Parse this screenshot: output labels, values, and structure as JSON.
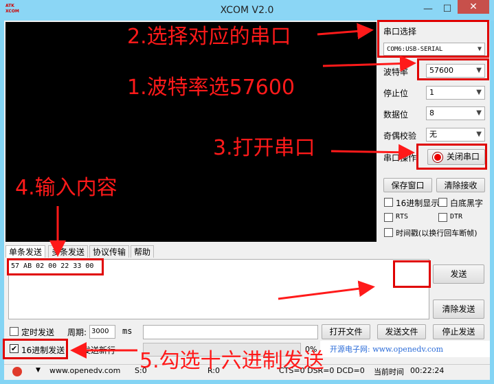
{
  "window": {
    "title": "XCOM V2.0",
    "logo_text": "ATK XCOM",
    "minimize": "—",
    "maximize": "☐",
    "close": "✕"
  },
  "serial": {
    "port_label": "串口选择",
    "port_value": "COM6:USB-SERIAL",
    "baud_label": "波特率",
    "baud_value": "57600",
    "stop_label": "停止位",
    "stop_value": "1",
    "data_label": "数据位",
    "data_value": "8",
    "parity_label": "奇偶校验",
    "parity_value": "无",
    "op_label": "串口操作",
    "op_button": "关闭串口"
  },
  "right_panel": {
    "save_window": "保存窗口",
    "clear_receive": "清除接收",
    "hex_display": "16进制显示",
    "white_black": "白底黑字",
    "rts": "RTS",
    "dtr": "DTR",
    "timestamp": "时间戳(以换行回车断帧)"
  },
  "tabs": [
    "单条发送",
    "多条发送",
    "协议传输",
    "帮助"
  ],
  "send": {
    "content": "57 AB 02 00 22 33 00",
    "send_button": "发送",
    "clear_send_button": "清除发送",
    "timed_send": "定时发送",
    "period_label": "周期:",
    "period_value": "3000",
    "period_unit": "ms",
    "open_file": "打开文件",
    "send_file": "发送文件",
    "stop_send": "停止发送",
    "hex_send": "16进制发送",
    "newline": "发送新行",
    "progress": "0%",
    "site_banner": "开源电子网: www.openedv.com"
  },
  "status_bar": {
    "url": "www.openedv.com",
    "s": "S:0",
    "r": "R:0",
    "signals": "CTS=0 DSR=0 DCD=0",
    "time_label": "当前时间",
    "time": "00:22:24"
  },
  "annotations": {
    "a1": "1.波特率选57600",
    "a2": "2.选择对应的串口",
    "a3": "3.打开串口",
    "a4": "4.输入内容",
    "a5": "5.勾选十六进制发送"
  },
  "colors": {
    "annotation": "#ff1a1a",
    "receive_bg": "#000000",
    "frame": "#84d4f4"
  }
}
